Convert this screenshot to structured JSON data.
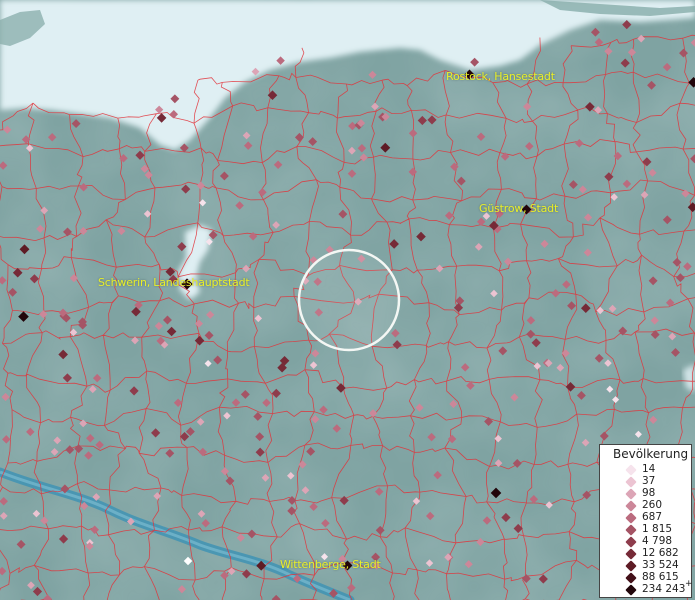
{
  "map": {
    "cities": [
      {
        "id": "rostock",
        "label": "Rostock, Hansestadt"
      },
      {
        "id": "guestrow",
        "label": "Güstrow, Stadt"
      },
      {
        "id": "schwerin",
        "label": "Schwerin, Landeshauptstadt"
      },
      {
        "id": "wittenberge",
        "label": "Wittenberge, Stadt"
      }
    ],
    "colors": {
      "land": "#7fa3a2",
      "water": "#dfeff3",
      "boundary": "#e2323a",
      "label": "#e8ef2a",
      "river": "#3f93b4"
    }
  },
  "legend": {
    "title": "Bevölkerung",
    "overflow_mark": "+",
    "classes": [
      {
        "label": "14",
        "color": "#f6e3ec"
      },
      {
        "label": "37",
        "color": "#ecc4d2"
      },
      {
        "label": "98",
        "color": "#dca5b6"
      },
      {
        "label": "260",
        "color": "#cc8799"
      },
      {
        "label": "687",
        "color": "#bb6b7e"
      },
      {
        "label": "1 815",
        "color": "#a55465"
      },
      {
        "label": "4 798",
        "color": "#8e3c4c"
      },
      {
        "label": "12 682",
        "color": "#762a37"
      },
      {
        "label": "33 524",
        "color": "#5e1b25"
      },
      {
        "label": "88 615",
        "color": "#431018"
      },
      {
        "label": "234 243",
        "color": "#22060b"
      }
    ]
  }
}
